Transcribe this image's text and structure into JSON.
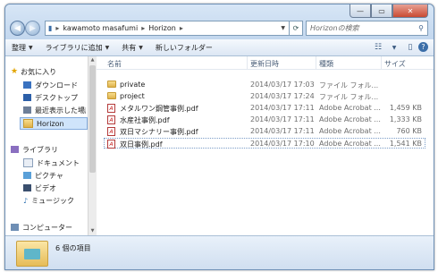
{
  "window": {
    "controls": {
      "minimize": "—",
      "maximize": "▭",
      "close": "✕"
    }
  },
  "address": {
    "segments": [
      "kawamoto masafumi",
      "Horizon"
    ],
    "separator": "▸"
  },
  "search": {
    "placeholder": "Horizonの検索"
  },
  "toolbar": {
    "organize": "整理",
    "include_library": "ライブラリに追加",
    "share": "共有",
    "new_folder": "新しいフォルダー"
  },
  "nav": {
    "favorites": "お気に入り",
    "downloads": "ダウンロード",
    "desktop": "デスクトップ",
    "recent": "最近表示した場所",
    "horizon": "Horizon",
    "libraries": "ライブラリ",
    "documents": "ドキュメント",
    "pictures": "ピクチャ",
    "videos": "ビデオ",
    "music": "ミュージック",
    "computer": "コンピューター"
  },
  "columns": {
    "name": "名前",
    "date": "更新日時",
    "type": "種類",
    "size": "サイズ"
  },
  "files": [
    {
      "icon": "folder-icon",
      "name": "private",
      "date": "2014/03/17 17:03",
      "type": "ファイル フォル...",
      "size": ""
    },
    {
      "icon": "folder-icon",
      "name": "project",
      "date": "2014/03/17 17:24",
      "type": "ファイル フォル...",
      "size": ""
    },
    {
      "icon": "pdf-icon",
      "name": "メタルワン鋼管事例.pdf",
      "date": "2014/03/17 17:11",
      "type": "Adobe Acrobat ...",
      "size": "1,459 KB"
    },
    {
      "icon": "pdf-icon",
      "name": "水産社事例.pdf",
      "date": "2014/03/17 17:11",
      "type": "Adobe Acrobat ...",
      "size": "1,333 KB"
    },
    {
      "icon": "pdf-icon",
      "name": "双日マシナリー事例.pdf",
      "date": "2014/03/17 17:11",
      "type": "Adobe Acrobat ...",
      "size": "760 KB"
    },
    {
      "icon": "pdf-icon",
      "name": "双日事例.pdf",
      "date": "2014/03/17 17:10",
      "type": "Adobe Acrobat ...",
      "size": "1,541 KB"
    }
  ],
  "details": {
    "count": "6 個の項目"
  },
  "colors": {
    "title_bar": "#c9dbef",
    "selection": "#cfe4fb",
    "close_button": "#c94a33"
  }
}
